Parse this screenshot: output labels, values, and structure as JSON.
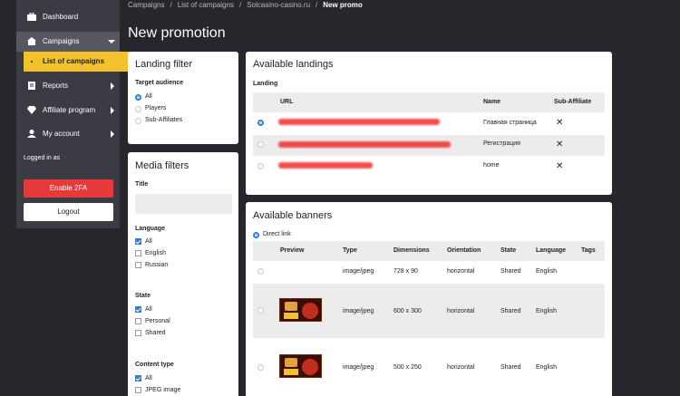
{
  "sidebar": {
    "items": [
      {
        "label": "Dashboard",
        "icon": "briefcase-icon"
      },
      {
        "label": "Campaigns",
        "icon": "home-icon"
      },
      {
        "label": "Reports",
        "icon": "file-icon"
      },
      {
        "label": "Affiliate program",
        "icon": "diamond-icon"
      },
      {
        "label": "My account",
        "icon": "user-icon"
      }
    ],
    "sub_item": "List of campaigns",
    "logged_in": "Logged in as",
    "enable_2fa": "Enable 2FA",
    "logout": "Logout"
  },
  "breadcrumb": [
    "Campaigns",
    "List of campaigns",
    "Solcasino-casino.ru",
    "New promo"
  ],
  "page_title": "New promotion",
  "landing_filter": {
    "title": "Landing filter",
    "target_label": "Target audience",
    "options": [
      "All",
      "Players",
      "Sub-Affiliates"
    ]
  },
  "media_filters": {
    "title": "Media filters",
    "title_label": "Title",
    "language_label": "Language",
    "language_options": [
      "All",
      "English",
      "Russian"
    ],
    "state_label": "State",
    "state_options": [
      "All",
      "Personal",
      "Shared"
    ],
    "content_label": "Content type",
    "content_options": [
      "All",
      "JPEG image"
    ]
  },
  "landings": {
    "title": "Available landings",
    "section_label": "Landing",
    "headers": {
      "url": "URL",
      "name": "Name",
      "sub": "Sub-Affiliate"
    },
    "rows": [
      {
        "name": "Главная страница"
      },
      {
        "name": "Регистрация"
      },
      {
        "name": "home"
      }
    ]
  },
  "banners": {
    "title": "Available banners",
    "direct_link": "Direct link",
    "headers": {
      "preview": "Preview",
      "type": "Type",
      "dimensions": "Dimensions",
      "orientation": "Orientation",
      "state": "State",
      "language": "Language",
      "tags": "Tags"
    },
    "rows": [
      {
        "type": "image/jpeg",
        "dimensions": "728 x 90",
        "orientation": "horizontal",
        "state": "Shared",
        "language": "English"
      },
      {
        "type": "image/jpeg",
        "dimensions": "600 x 300",
        "orientation": "horizontal",
        "state": "Shared",
        "language": "English"
      },
      {
        "type": "image/jpeg",
        "dimensions": "500 x 250",
        "orientation": "horizontal",
        "state": "Shared",
        "language": "English"
      }
    ]
  },
  "colors": {
    "accent": "#f2c12c",
    "danger": "#e63a3a",
    "primary": "#2f7fd3"
  }
}
